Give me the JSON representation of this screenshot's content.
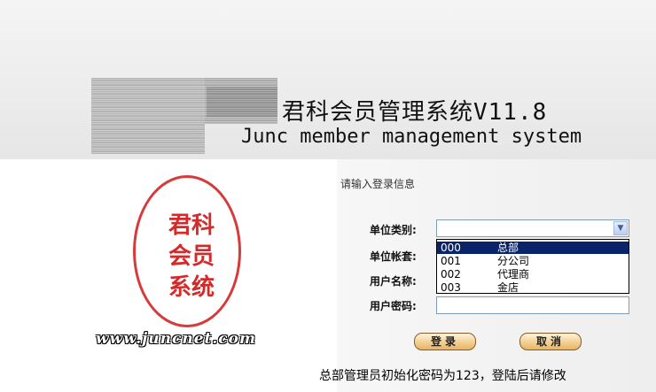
{
  "app": {
    "title_cn": "君科会员管理系统V11.8",
    "title_en": "Junc member management system"
  },
  "branding": {
    "stamp_line1": "君科",
    "stamp_line2": "会员",
    "stamp_line3": "系统",
    "website": "www.juncnet.com",
    "stamp_color": "#d42a2a"
  },
  "login": {
    "prompt": "请输入登录信息",
    "unit_type_label": "单位类别:",
    "unit_account_label": "单位帐套:",
    "username_label": "用户名称:",
    "password_label": "用户密码:",
    "unit_type_value": "",
    "unit_type_options": [
      {
        "code": "000",
        "name": "总部",
        "selected": true
      },
      {
        "code": "001",
        "name": "分公司",
        "selected": false
      },
      {
        "code": "002",
        "name": "代理商",
        "selected": false
      },
      {
        "code": "003",
        "name": "金店",
        "selected": false
      }
    ],
    "login_button": "登录",
    "cancel_button": "取消",
    "notice": "总部管理员初始化密码为123，登陆后请修改"
  },
  "colors": {
    "selection": "#0a246a",
    "button_border": "#8a5a2a"
  }
}
